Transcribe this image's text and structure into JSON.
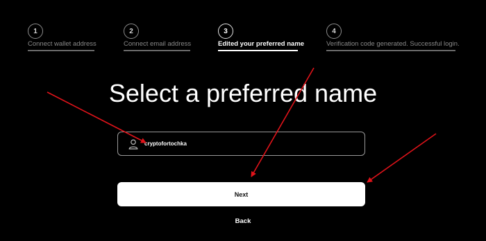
{
  "stepper": {
    "steps": [
      {
        "number": "1",
        "label": "Connect wallet address"
      },
      {
        "number": "2",
        "label": "Connect email address"
      },
      {
        "number": "3",
        "label": "Edited your preferred name"
      },
      {
        "number": "4",
        "label": "Verification code generated. Successful login."
      }
    ],
    "active_step": 3
  },
  "main": {
    "title": "Select a preferred name",
    "name_input": {
      "value": "cryptofortochka",
      "icon": "user-icon"
    },
    "next_label": "Next",
    "back_label": "Back"
  },
  "colors": {
    "background": "#000000",
    "text": "#ffffff",
    "muted": "#8a8a8a",
    "button_bg": "#ffffff",
    "annotation_arrow": "#e0131a"
  }
}
